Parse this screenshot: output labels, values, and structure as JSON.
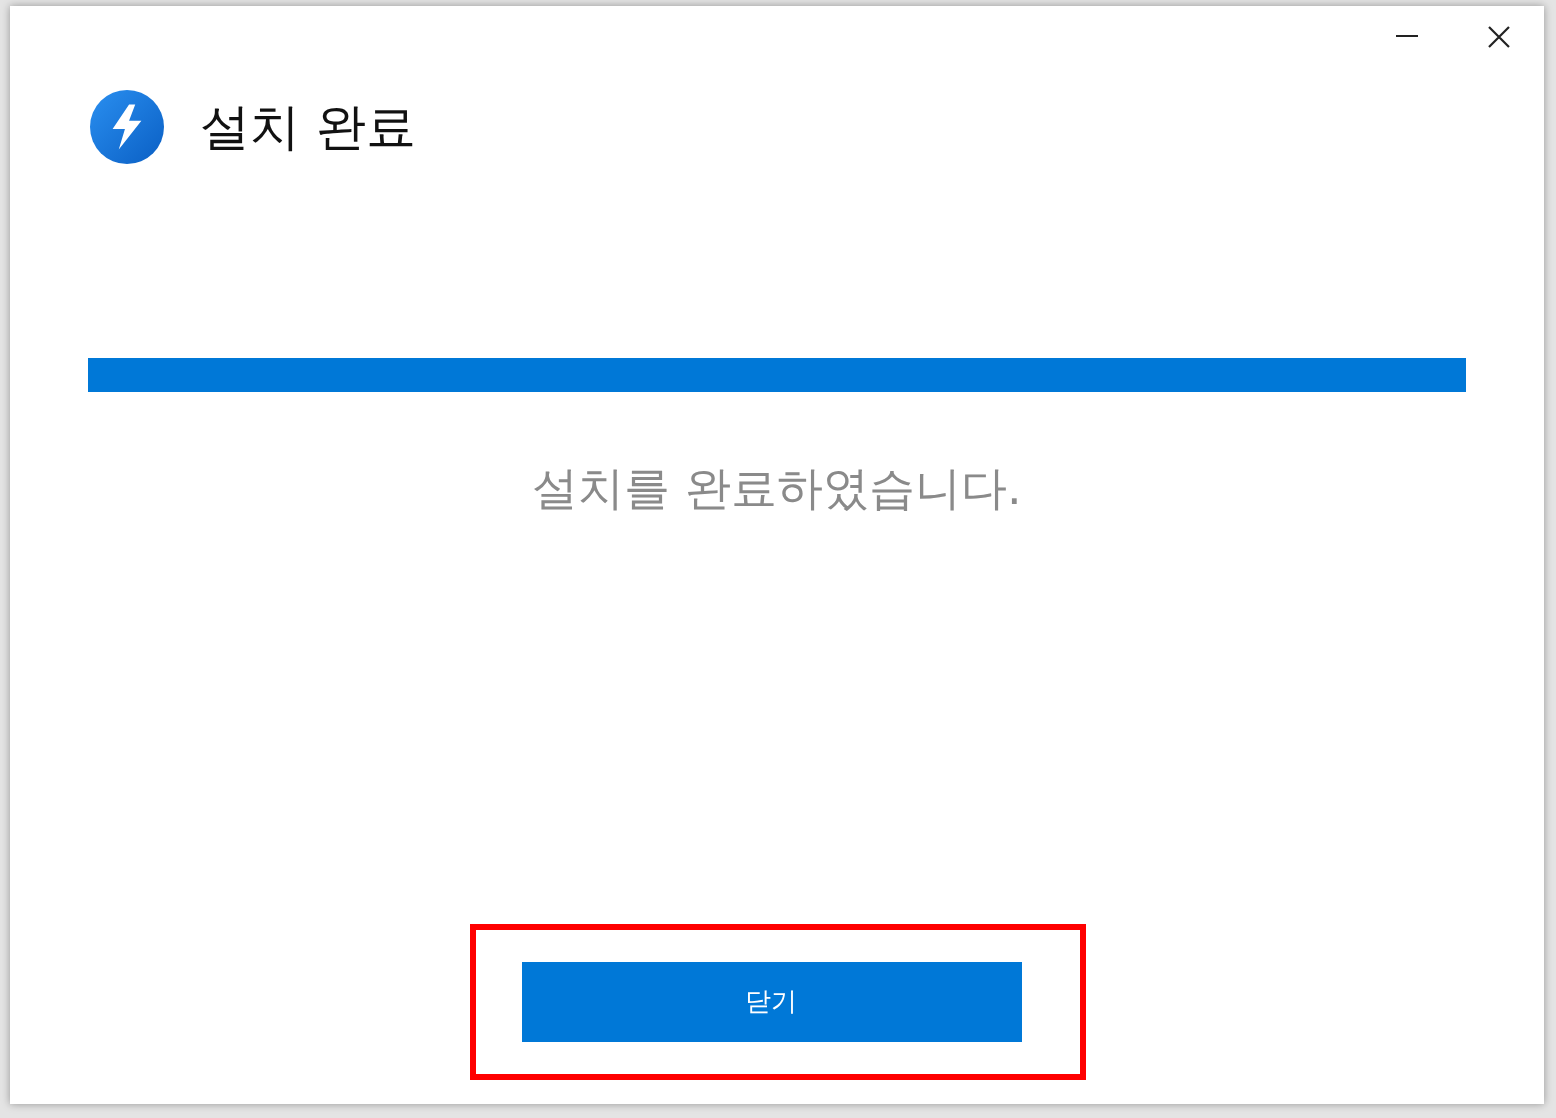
{
  "dialog": {
    "title": "설치 완료",
    "progress": {
      "level": 1
    },
    "message": "설치를 완료하였습니다.",
    "buttons": [
      {
        "label": "닫기",
        "highlighted": true
      }
    ]
  }
}
